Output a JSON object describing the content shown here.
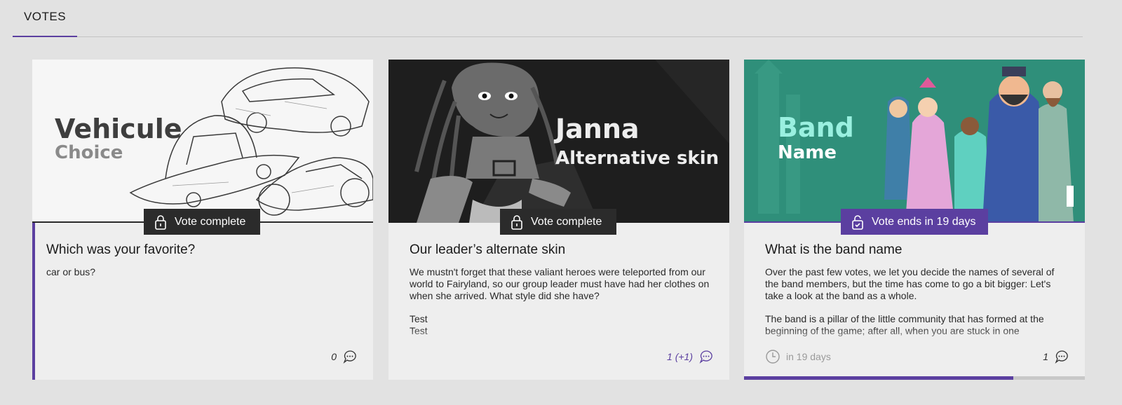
{
  "tabs": [
    {
      "label": "VOTES"
    }
  ],
  "colors": {
    "accent": "#5b3fa0",
    "badge_dark": "#2b2b2b"
  },
  "cards": [
    {
      "banner_title": "Vehicule",
      "banner_subtitle": "Choice",
      "status": "Vote complete",
      "status_icon": "lock-icon",
      "title": "Which was your favorite?",
      "description": [
        "car or bus?"
      ],
      "comment_count": "0"
    },
    {
      "banner_title": "Janna",
      "banner_subtitle": "Alternative skin",
      "status": "Vote complete",
      "status_icon": "lock-icon",
      "title": "Our leader’s alternate skin",
      "description": [
        "We mustn't forget that these valiant heroes were teleported from our world to Fairyland, so our group leader must have had her clothes on when she arrived. What style did she have?",
        "Test\nTest"
      ],
      "comment_count": "1 (+1)"
    },
    {
      "banner_title": "Band",
      "banner_subtitle": "Name",
      "status": "Vote ends in 19 days",
      "status_icon": "unlock-icon",
      "title": "What is the band name",
      "description": [
        "Over the past few votes, we let you decide the names of several of the band members, but the time has come to go a bit bigger: Let's take a look at the band as a whole.",
        "The band is a pillar of the little community that has formed at the beginning of the game; after all, when you are stuck in one"
      ],
      "time_left": "in 19 days",
      "comment_count": "1",
      "progress": 0.79
    }
  ]
}
